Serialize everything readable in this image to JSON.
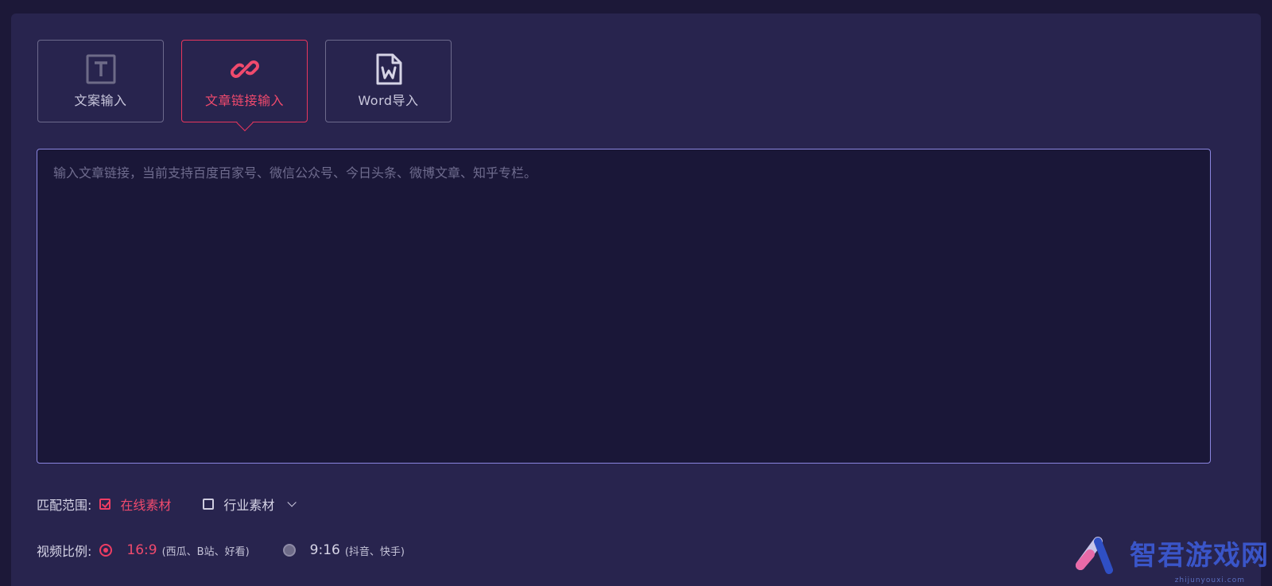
{
  "tabs": [
    {
      "label": "文案输入",
      "icon": "text-icon",
      "active": false
    },
    {
      "label": "文章链接输入",
      "icon": "link-icon",
      "active": true
    },
    {
      "label": "Word导入",
      "icon": "word-file-icon",
      "active": false
    }
  ],
  "input": {
    "value": "",
    "placeholder": "输入文章链接，当前支持百度百家号、微信公众号、今日头条、微博文章、知乎专栏。"
  },
  "match_scope": {
    "label": "匹配范围:",
    "options": [
      {
        "label": "在线素材",
        "checked": true
      },
      {
        "label": "行业素材",
        "checked": false
      }
    ]
  },
  "video_ratio": {
    "label": "视频比例:",
    "options": [
      {
        "ratio": "16:9",
        "note": "(西瓜、B站、好看)",
        "selected": true
      },
      {
        "ratio": "9:16",
        "note": "(抖音、快手)",
        "selected": false
      }
    ]
  },
  "watermark": {
    "text": "智君游戏网",
    "sub": "zhijunyouxi.com"
  },
  "colors": {
    "accent": "#e8365d",
    "panel": "#28244e",
    "input_border": "#8b86e0"
  }
}
